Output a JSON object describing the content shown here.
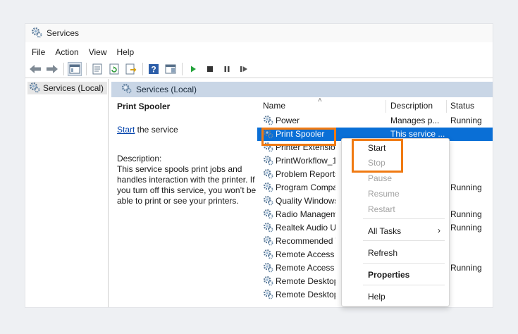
{
  "window": {
    "title": "Services"
  },
  "menu": [
    "File",
    "Action",
    "View",
    "Help"
  ],
  "tree": {
    "root": "Services (Local)"
  },
  "panel": {
    "header": "Services (Local)"
  },
  "details": {
    "service_name": "Print Spooler",
    "start_link": "Start",
    "start_suffix": " the service",
    "description_label": "Description:",
    "description_text": "This service spools print jobs and handles interaction with the printer. If you turn off this service, you won’t be able to print or see your printers."
  },
  "columns": {
    "name": "Name",
    "description": "Description",
    "status": "Status"
  },
  "services": [
    {
      "name": "Power",
      "description": "Manages p...",
      "status": "Running"
    },
    {
      "name": "Print Spooler",
      "description": "This service ...",
      "status": "",
      "selected": true
    },
    {
      "name": "Printer Extensions",
      "description": "",
      "status": ""
    },
    {
      "name": "PrintWorkflow_1",
      "description": "",
      "status": ""
    },
    {
      "name": "Problem Reports",
      "description": "",
      "status": ""
    },
    {
      "name": "Program Compatibility",
      "description": "",
      "status": "Running"
    },
    {
      "name": "Quality Windows",
      "description": "",
      "status": ""
    },
    {
      "name": "Radio Management",
      "description": "",
      "status": "Running"
    },
    {
      "name": "Realtek Audio Universal",
      "description": "",
      "status": "Running"
    },
    {
      "name": "Recommended Troubleshooting",
      "description": "",
      "status": ""
    },
    {
      "name": "Remote Access Auto",
      "description": "",
      "status": ""
    },
    {
      "name": "Remote Access Connection",
      "description": "",
      "status": "Running"
    },
    {
      "name": "Remote Desktop",
      "description": "",
      "status": ""
    },
    {
      "name": "Remote Desktop",
      "description": "",
      "status": ""
    }
  ],
  "context_menu": {
    "start": "Start",
    "stop": "Stop",
    "pause": "Pause",
    "resume": "Resume",
    "restart": "Restart",
    "all_tasks": "All Tasks",
    "all_tasks_arrow": "›",
    "refresh": "Refresh",
    "properties": "Properties",
    "help": "Help"
  },
  "colors": {
    "highlight": "#f07a12",
    "selection": "#0a6fd6",
    "panel_header": "#c9d6e6"
  }
}
